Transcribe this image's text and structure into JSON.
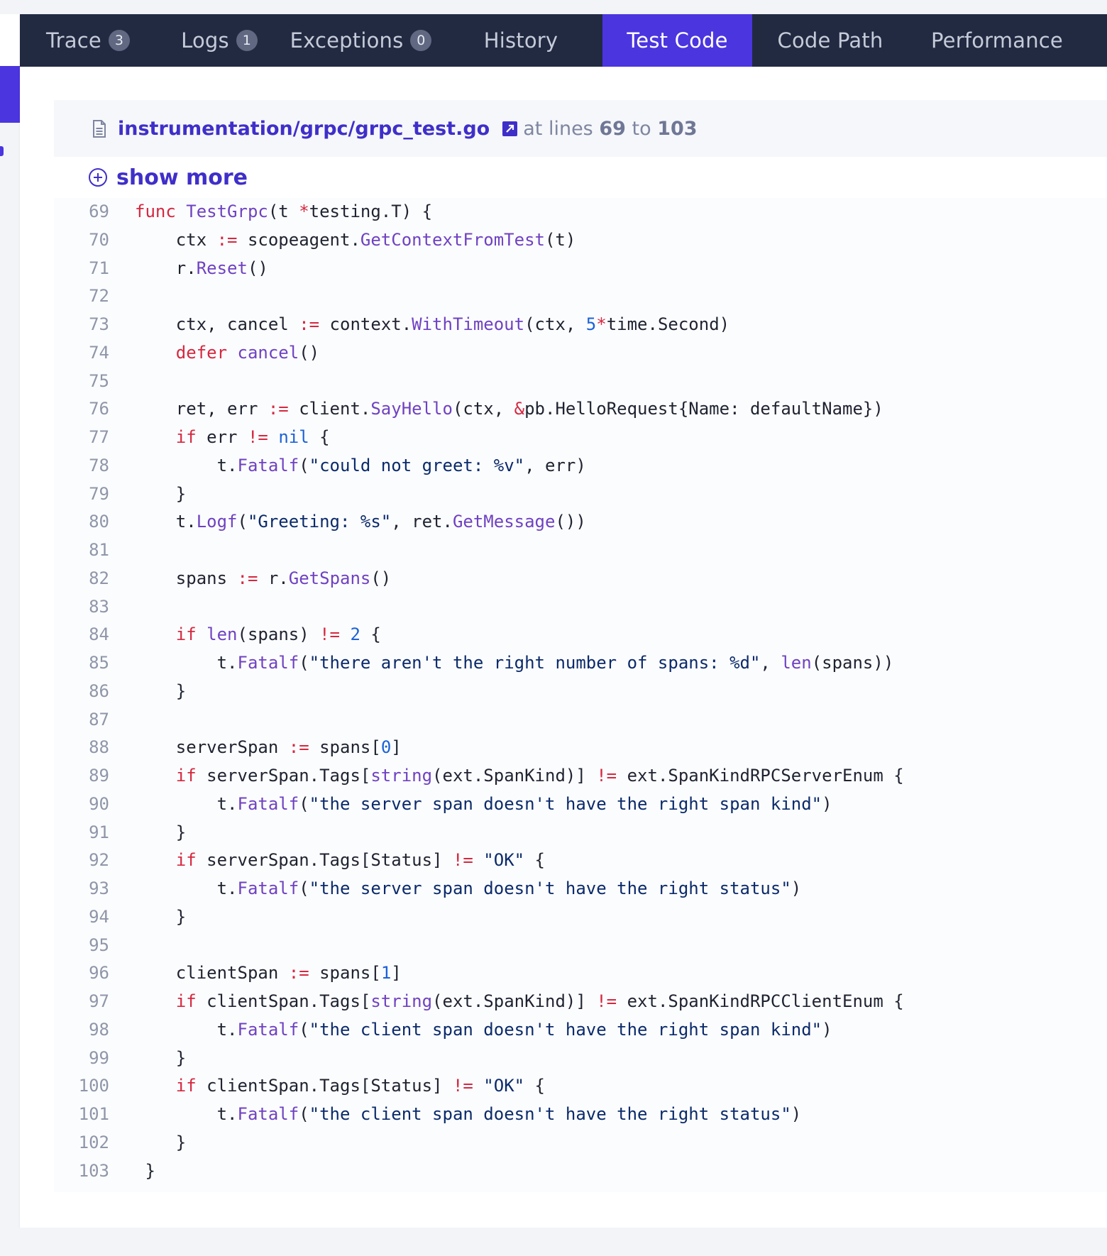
{
  "tabs": [
    {
      "label": "Trace",
      "badge": "3",
      "width": 192
    },
    {
      "label": "Logs",
      "badge": "1",
      "width": 178
    },
    {
      "label": "Exceptions",
      "badge": "0",
      "width": 221
    },
    {
      "label": "History",
      "badge": null,
      "width": 230
    },
    {
      "label": "Test Code",
      "badge": null,
      "width": 211,
      "active": true
    },
    {
      "label": "Code Path",
      "badge": null,
      "width": 220
    },
    {
      "label": "Performance",
      "badge": null,
      "width": 250
    }
  ],
  "file": {
    "path": "instrumentation/grpc/grpc_test.go",
    "at_lines": "at lines",
    "start_line": "69",
    "to": "to",
    "end_line": "103"
  },
  "show_more_label": "show more",
  "code_lines": [
    {
      "n": "69",
      "src": "func TestGrpc(t *testing.T) {"
    },
    {
      "n": "70",
      "src": "    ctx := scopeagent.GetContextFromTest(t)"
    },
    {
      "n": "71",
      "src": "    r.Reset()"
    },
    {
      "n": "72",
      "src": ""
    },
    {
      "n": "73",
      "src": "    ctx, cancel := context.WithTimeout(ctx, 5*time.Second)"
    },
    {
      "n": "74",
      "src": "    defer cancel()"
    },
    {
      "n": "75",
      "src": ""
    },
    {
      "n": "76",
      "src": "    ret, err := client.SayHello(ctx, &pb.HelloRequest{Name: defaultName})"
    },
    {
      "n": "77",
      "src": "    if err != nil {"
    },
    {
      "n": "78",
      "src": "        t.Fatalf(\"could not greet: %v\", err)"
    },
    {
      "n": "79",
      "src": "    }"
    },
    {
      "n": "80",
      "src": "    t.Logf(\"Greeting: %s\", ret.GetMessage())"
    },
    {
      "n": "81",
      "src": ""
    },
    {
      "n": "82",
      "src": "    spans := r.GetSpans()"
    },
    {
      "n": "83",
      "src": ""
    },
    {
      "n": "84",
      "src": "    if len(spans) != 2 {"
    },
    {
      "n": "85",
      "src": "        t.Fatalf(\"there aren't the right number of spans: %d\", len(spans))"
    },
    {
      "n": "86",
      "src": "    }"
    },
    {
      "n": "87",
      "src": ""
    },
    {
      "n": "88",
      "src": "    serverSpan := spans[0]"
    },
    {
      "n": "89",
      "src": "    if serverSpan.Tags[string(ext.SpanKind)] != ext.SpanKindRPCServerEnum {"
    },
    {
      "n": "90",
      "src": "        t.Fatalf(\"the server span doesn't have the right span kind\")"
    },
    {
      "n": "91",
      "src": "    }"
    },
    {
      "n": "92",
      "src": "    if serverSpan.Tags[Status] != \"OK\" {"
    },
    {
      "n": "93",
      "src": "        t.Fatalf(\"the server span doesn't have the right status\")"
    },
    {
      "n": "94",
      "src": "    }"
    },
    {
      "n": "95",
      "src": ""
    },
    {
      "n": "96",
      "src": "    clientSpan := spans[1]"
    },
    {
      "n": "97",
      "src": "    if clientSpan.Tags[string(ext.SpanKind)] != ext.SpanKindRPCClientEnum {"
    },
    {
      "n": "98",
      "src": "        t.Fatalf(\"the client span doesn't have the right span kind\")"
    },
    {
      "n": "99",
      "src": "    }"
    },
    {
      "n": "100",
      "src": "    if clientSpan.Tags[Status] != \"OK\" {"
    },
    {
      "n": "101",
      "src": "        t.Fatalf(\"the client span doesn't have the right status\")"
    },
    {
      "n": "102",
      "src": "    }"
    },
    {
      "n": "103",
      "src": " }"
    }
  ],
  "colors": {
    "accent": "#4b35df",
    "tabbar": "#222a42",
    "keyword": "#d5283f",
    "function": "#6f42c1",
    "string": "#0b2a6a",
    "number": "#1b62d6"
  },
  "icons": {
    "file": "file-icon",
    "external_link": "external-link-icon",
    "show_more": "plus-circle-icon"
  }
}
